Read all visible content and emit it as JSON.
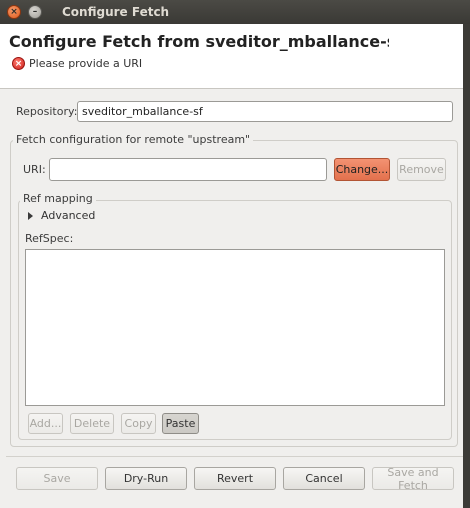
{
  "window": {
    "title": "Configure Fetch"
  },
  "header": {
    "title": "Configure Fetch from sveditor_mballance-sf - upst",
    "error_message": "Please provide a URI"
  },
  "repository": {
    "label": "Repository:",
    "value": "sveditor_mballance-sf"
  },
  "fetch_group": {
    "title": "Fetch configuration for remote \"upstream\"",
    "uri_label": "URI:",
    "uri_value": "",
    "change_label": "Change...",
    "remove_label": "Remove"
  },
  "ref_mapping": {
    "title": "Ref mapping",
    "advanced_label": "Advanced",
    "refspec_label": "RefSpec:",
    "add_label": "Add...",
    "delete_label": "Delete",
    "copy_label": "Copy",
    "paste_label": "Paste"
  },
  "footer": {
    "save_label": "Save",
    "dryrun_label": "Dry-Run",
    "revert_label": "Revert",
    "cancel_label": "Cancel",
    "save_fetch_label": "Save and Fetch"
  },
  "colors": {
    "accent": "#e3714d",
    "error": "#cc1f1a",
    "titlebar": "#3c3b37"
  }
}
